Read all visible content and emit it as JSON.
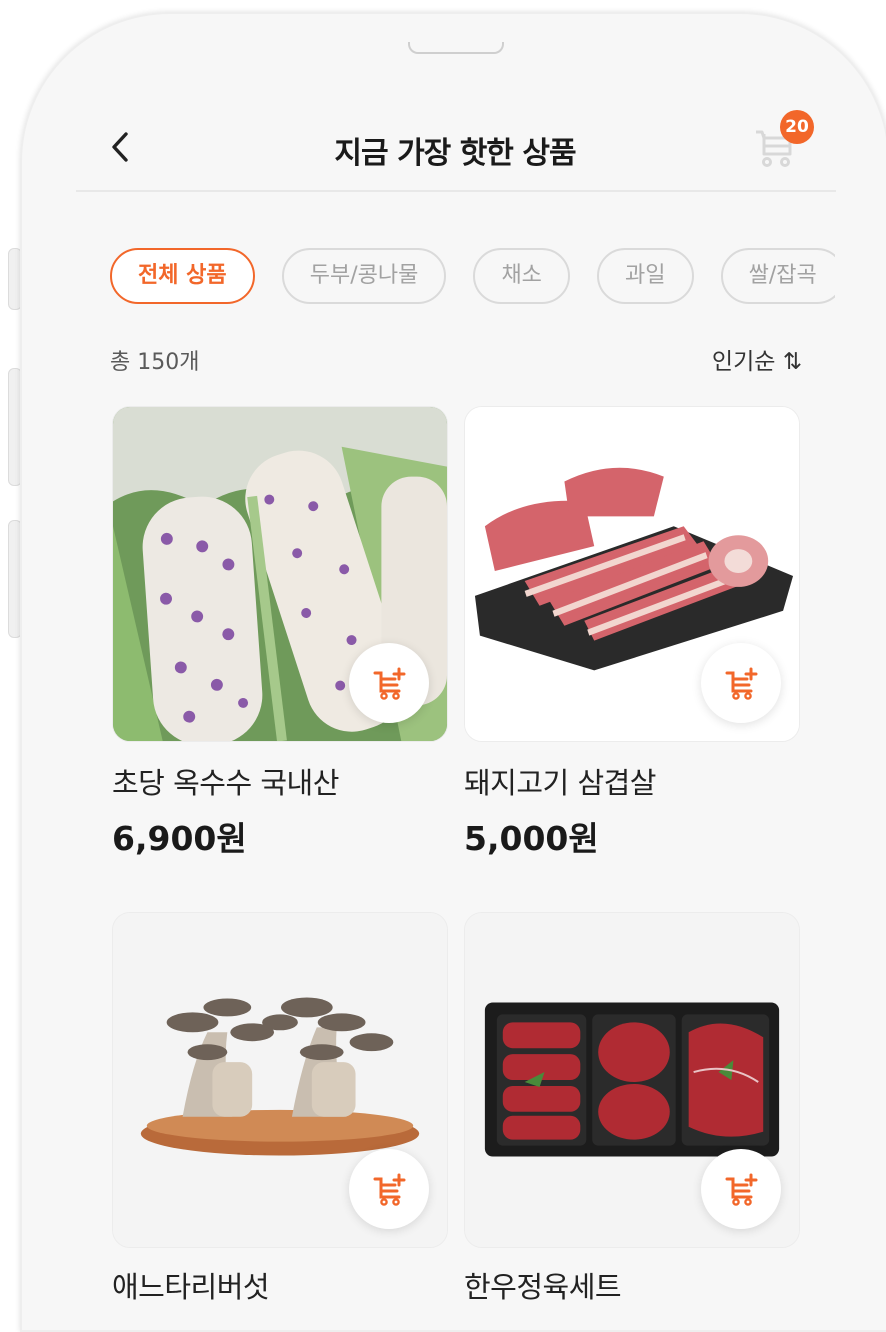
{
  "header": {
    "title": "지금 가장 핫한 상품",
    "cart_count": "20"
  },
  "filters": {
    "chips": [
      {
        "label": "전체 상품",
        "active": true
      },
      {
        "label": "두부/콩나물",
        "active": false
      },
      {
        "label": "채소",
        "active": false
      },
      {
        "label": "과일",
        "active": false
      },
      {
        "label": "쌀/잡곡",
        "active": false
      }
    ]
  },
  "list": {
    "total_label": "총 150개",
    "sort_label": "인기순 ⇅"
  },
  "products": [
    {
      "name": "초당 옥수수 국내산",
      "price": "6,900원",
      "image": "corn"
    },
    {
      "name": "돼지고기 삼겹살",
      "price": "5,000원",
      "image": "pork-belly"
    },
    {
      "name": "애느타리버섯",
      "price": "",
      "image": "mushroom"
    },
    {
      "name": "한우정육세트",
      "price": "",
      "image": "beef-set"
    }
  ],
  "colors": {
    "accent": "#f2672a",
    "background": "#f7f7f7"
  }
}
